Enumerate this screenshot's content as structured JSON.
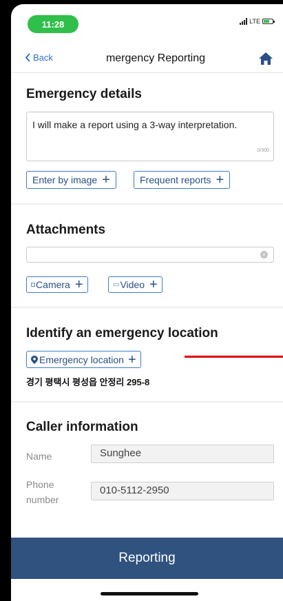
{
  "status_bar": {
    "time": "11:28",
    "network": "LTE"
  },
  "nav": {
    "back_label": "Back",
    "title": "mergency Reporting",
    "home_icon": "home-icon"
  },
  "emergency_details": {
    "heading": "Emergency details",
    "text": "I will make a report using a 3-way interpretation.",
    "counter": "0/300",
    "enter_by_image": "Enter by image",
    "frequent_reports": "Frequent reports"
  },
  "attachments": {
    "heading": "Attachments",
    "camera": "Camera",
    "video": "Video"
  },
  "location": {
    "heading": "Identify an emergency location",
    "button": "Emergency location",
    "address": "경기 평택시 평성읍 안정리 295-8"
  },
  "caller": {
    "heading": "Caller information",
    "name_label": "Name",
    "name_value": "Sunghee",
    "phone_label_line1": "Phone",
    "phone_label_line2": "number",
    "phone_value": "010-5112-2950"
  },
  "submit_label": "Reporting",
  "colors": {
    "accent": "#3c7cc8",
    "submit": "#2f527f",
    "time_pill": "#2fbf4a",
    "annotation": "#e00000"
  }
}
